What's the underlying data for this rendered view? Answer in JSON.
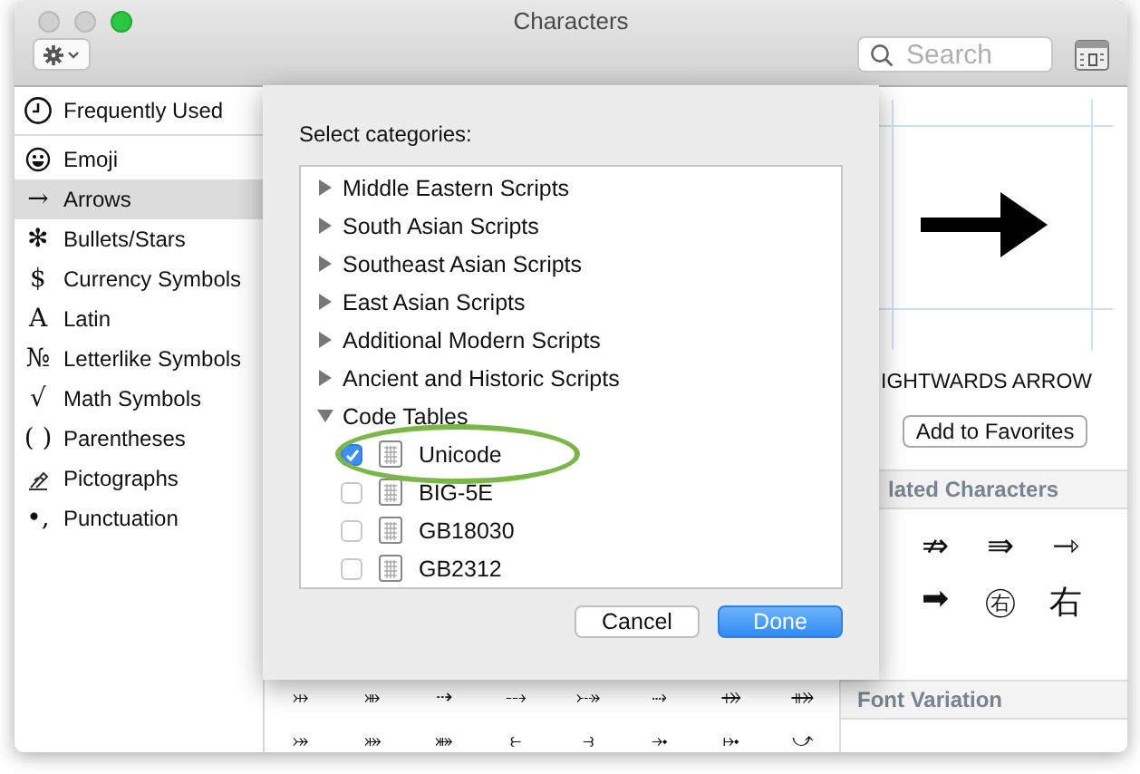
{
  "window": {
    "title": "Characters"
  },
  "toolbar": {
    "search": {
      "placeholder": "Search"
    }
  },
  "sidebar": {
    "items": [
      {
        "label": "Frequently Used",
        "kind": "clock",
        "selected": false
      },
      {
        "label": "Emoji",
        "kind": "smiley",
        "selected": false
      },
      {
        "label": "Arrows",
        "kind": "glyph",
        "glyph": "→",
        "selected": true
      },
      {
        "label": "Bullets/Stars",
        "kind": "glyph",
        "glyph": "✻",
        "selected": false
      },
      {
        "label": "Currency Symbols",
        "kind": "glyph",
        "glyph": "$",
        "selected": false
      },
      {
        "label": "Latin",
        "kind": "glyph",
        "glyph": "A",
        "selected": false
      },
      {
        "label": "Letterlike Symbols",
        "kind": "glyph",
        "glyph": "№",
        "selected": false
      },
      {
        "label": "Math Symbols",
        "kind": "glyph",
        "glyph": "√",
        "selected": false
      },
      {
        "label": "Parentheses",
        "kind": "glyph",
        "glyph": "( )",
        "selected": false
      },
      {
        "label": "Pictographs",
        "kind": "pen",
        "selected": false
      },
      {
        "label": "Punctuation",
        "kind": "glyph",
        "glyph": "•,",
        "selected": false
      }
    ]
  },
  "character_grid": {
    "rows": [
      [
        "⤔",
        "⤕",
        "⇢",
        "⤏",
        "⤐",
        "⤑",
        "⤀",
        "⤁"
      ],
      [
        "⤖",
        "⤗",
        "⤘",
        "⥼",
        "⥽",
        "⤞",
        "⤠",
        "⤻"
      ]
    ]
  },
  "detail": {
    "name": "IGHTWARDS ARROW",
    "favorites_button": "Add to Favorites",
    "related_header": "lated Characters",
    "related": [
      [
        "⇏",
        "⇛",
        "⇾"
      ],
      [
        "➡",
        "㊨",
        "右"
      ]
    ],
    "font_variation_header": "Font Variation"
  },
  "sheet": {
    "title": "Select categories:",
    "items": [
      {
        "label": "Middle Eastern Scripts",
        "expanded": false
      },
      {
        "label": "South Asian Scripts",
        "expanded": false
      },
      {
        "label": "Southeast Asian Scripts",
        "expanded": false
      },
      {
        "label": "East Asian Scripts",
        "expanded": false
      },
      {
        "label": "Additional Modern Scripts",
        "expanded": false
      },
      {
        "label": "Ancient and Historic Scripts",
        "expanded": false
      },
      {
        "label": "Code Tables",
        "expanded": true,
        "children": [
          {
            "label": "Unicode",
            "checked": true,
            "highlighted": true
          },
          {
            "label": "BIG-5E",
            "checked": false,
            "highlighted": false
          },
          {
            "label": "GB18030",
            "checked": false,
            "highlighted": false
          },
          {
            "label": "GB2312",
            "checked": false,
            "highlighted": false
          }
        ]
      }
    ],
    "buttons": [
      {
        "label": "Cancel",
        "kind": "secondary"
      },
      {
        "label": "Done",
        "kind": "primary"
      }
    ]
  }
}
